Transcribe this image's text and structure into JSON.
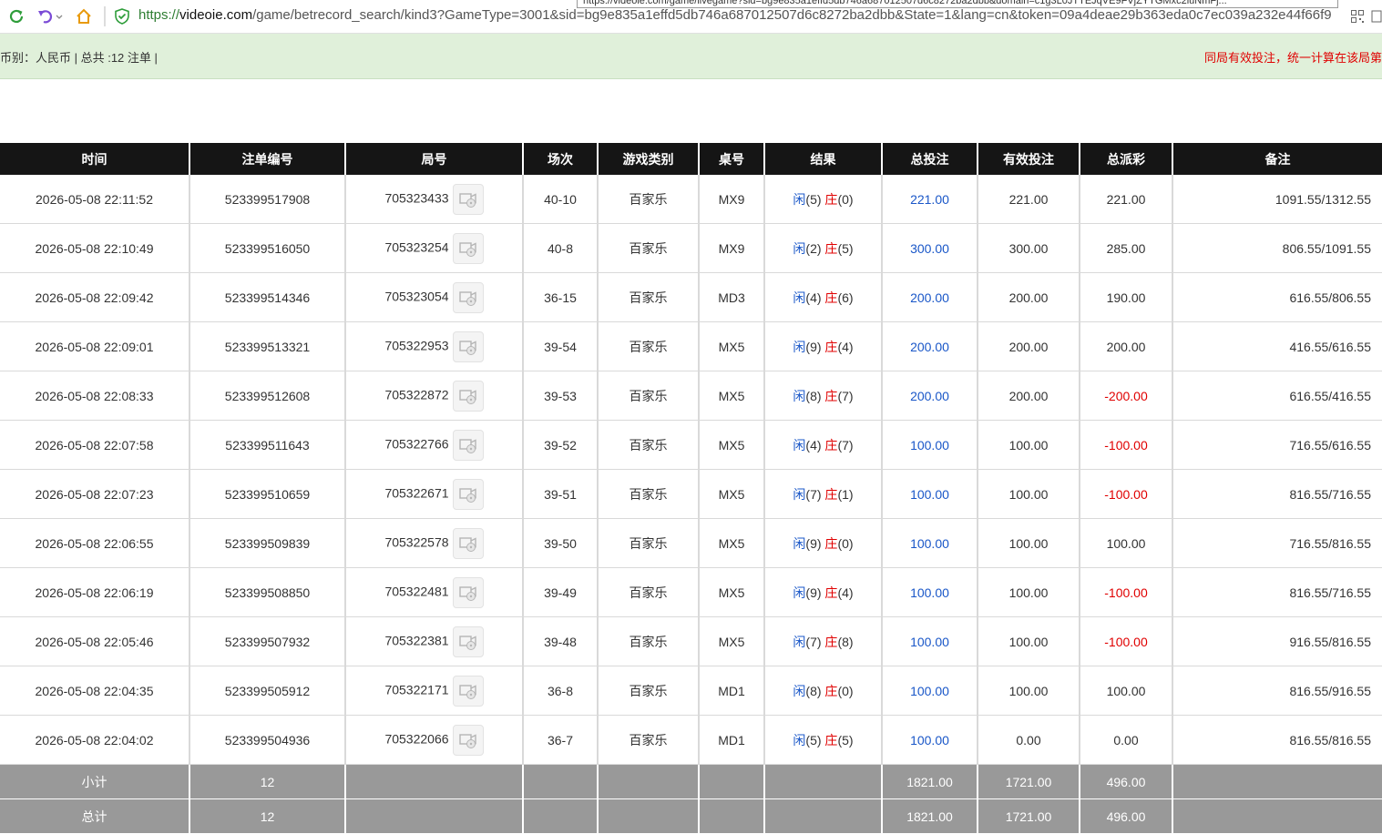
{
  "browser": {
    "url_scheme": "https://",
    "url_host": "videoie.com",
    "url_path": "/game/betrecord_search/kind3?GameType=3001&sid=bg9e835a1effd5db746a687012507d6c8272ba2dbb&State=1&lang=cn&token=09a4deae29b363eda0c7ec039a232e44f66f9",
    "hover_link": "https://videoie.com/game/livegame?sid=bg9e835a1effd5db746a687012507d6c8272ba2dbb&domain=c1g3L0JTTEJqVE9FVjZYTGMxc2luNmFj..."
  },
  "info": {
    "summary": "币别：人民币 | 总共 :12 注单 |",
    "notice": "同局有效投注，统一计算在该局第"
  },
  "table": {
    "headers": [
      "时间",
      "注单编号",
      "局号",
      "场次",
      "游戏类别",
      "桌号",
      "结果",
      "总投注",
      "有效投注",
      "总派彩",
      "备注"
    ],
    "player_label": "闲",
    "banker_label": "庄",
    "rows": [
      {
        "time": "2026-05-08 22:11:52",
        "bet_id": "523399517908",
        "round": "705323433",
        "session": "40-10",
        "game": "百家乐",
        "table": "MX9",
        "p": "(5)",
        "b": "(0)",
        "total": "221.00",
        "valid": "221.00",
        "payout": "221.00",
        "payout_neg": false,
        "note": "1091.55/1312.55"
      },
      {
        "time": "2026-05-08 22:10:49",
        "bet_id": "523399516050",
        "round": "705323254",
        "session": "40-8",
        "game": "百家乐",
        "table": "MX9",
        "p": "(2)",
        "b": "(5)",
        "total": "300.00",
        "valid": "300.00",
        "payout": "285.00",
        "payout_neg": false,
        "note": "806.55/1091.55"
      },
      {
        "time": "2026-05-08 22:09:42",
        "bet_id": "523399514346",
        "round": "705323054",
        "session": "36-15",
        "game": "百家乐",
        "table": "MD3",
        "p": "(4)",
        "b": "(6)",
        "total": "200.00",
        "valid": "200.00",
        "payout": "190.00",
        "payout_neg": false,
        "note": "616.55/806.55"
      },
      {
        "time": "2026-05-08 22:09:01",
        "bet_id": "523399513321",
        "round": "705322953",
        "session": "39-54",
        "game": "百家乐",
        "table": "MX5",
        "p": "(9)",
        "b": "(4)",
        "total": "200.00",
        "valid": "200.00",
        "payout": "200.00",
        "payout_neg": false,
        "note": "416.55/616.55"
      },
      {
        "time": "2026-05-08 22:08:33",
        "bet_id": "523399512608",
        "round": "705322872",
        "session": "39-53",
        "game": "百家乐",
        "table": "MX5",
        "p": "(8)",
        "b": "(7)",
        "total": "200.00",
        "valid": "200.00",
        "payout": "-200.00",
        "payout_neg": true,
        "note": "616.55/416.55"
      },
      {
        "time": "2026-05-08 22:07:58",
        "bet_id": "523399511643",
        "round": "705322766",
        "session": "39-52",
        "game": "百家乐",
        "table": "MX5",
        "p": "(4)",
        "b": "(7)",
        "total": "100.00",
        "valid": "100.00",
        "payout": "-100.00",
        "payout_neg": true,
        "note": "716.55/616.55"
      },
      {
        "time": "2026-05-08 22:07:23",
        "bet_id": "523399510659",
        "round": "705322671",
        "session": "39-51",
        "game": "百家乐",
        "table": "MX5",
        "p": "(7)",
        "b": "(1)",
        "total": "100.00",
        "valid": "100.00",
        "payout": "-100.00",
        "payout_neg": true,
        "note": "816.55/716.55"
      },
      {
        "time": "2026-05-08 22:06:55",
        "bet_id": "523399509839",
        "round": "705322578",
        "session": "39-50",
        "game": "百家乐",
        "table": "MX5",
        "p": "(9)",
        "b": "(0)",
        "total": "100.00",
        "valid": "100.00",
        "payout": "100.00",
        "payout_neg": false,
        "note": "716.55/816.55"
      },
      {
        "time": "2026-05-08 22:06:19",
        "bet_id": "523399508850",
        "round": "705322481",
        "session": "39-49",
        "game": "百家乐",
        "table": "MX5",
        "p": "(9)",
        "b": "(4)",
        "total": "100.00",
        "valid": "100.00",
        "payout": "-100.00",
        "payout_neg": true,
        "note": "816.55/716.55"
      },
      {
        "time": "2026-05-08 22:05:46",
        "bet_id": "523399507932",
        "round": "705322381",
        "session": "39-48",
        "game": "百家乐",
        "table": "MX5",
        "p": "(7)",
        "b": "(8)",
        "total": "100.00",
        "valid": "100.00",
        "payout": "-100.00",
        "payout_neg": true,
        "note": "916.55/816.55"
      },
      {
        "time": "2026-05-08 22:04:35",
        "bet_id": "523399505912",
        "round": "705322171",
        "session": "36-8",
        "game": "百家乐",
        "table": "MD1",
        "p": "(8)",
        "b": "(0)",
        "total": "100.00",
        "valid": "100.00",
        "payout": "100.00",
        "payout_neg": false,
        "note": "816.55/916.55"
      },
      {
        "time": "2026-05-08 22:04:02",
        "bet_id": "523399504936",
        "round": "705322066",
        "session": "36-7",
        "game": "百家乐",
        "table": "MD1",
        "p": "(5)",
        "b": "(5)",
        "total": "100.00",
        "valid": "0.00",
        "payout": "0.00",
        "payout_neg": false,
        "note": "816.55/816.55"
      }
    ],
    "subtotal": {
      "label": "小计",
      "count": "12",
      "total": "1821.00",
      "valid": "1721.00",
      "payout": "496.00"
    },
    "grandtotal": {
      "label": "总计",
      "count": "12",
      "total": "1821.00",
      "valid": "1721.00",
      "payout": "496.00"
    }
  },
  "colors": {
    "accent_blue": "#1a57c8",
    "negative_red": "#e00000",
    "header_bg": "#151515",
    "summary_bg": "#999999",
    "info_bg": "#e0f0da"
  }
}
